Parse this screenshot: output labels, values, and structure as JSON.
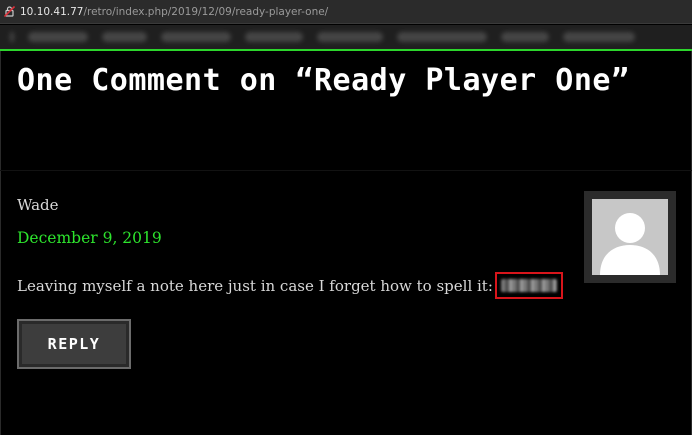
{
  "browser": {
    "url_host": "10.10.41.77",
    "url_path": "/retro/index.php/2019/12/09/ready-player-one/",
    "security_icon": "not-secure-icon",
    "accent_line_color": "#2cd52c"
  },
  "post": {
    "comments_title": "One Comment on “Ready Player One”"
  },
  "comment": {
    "author": "Wade",
    "date": "December 9, 2019",
    "text": "Leaving myself a note here just in case I forget how to spell it:",
    "avatar_icon": "default-user-avatar-icon",
    "date_color": "#2de42d",
    "highlight_color": "#d8151b"
  },
  "actions": {
    "reply_label": "REPLY"
  }
}
